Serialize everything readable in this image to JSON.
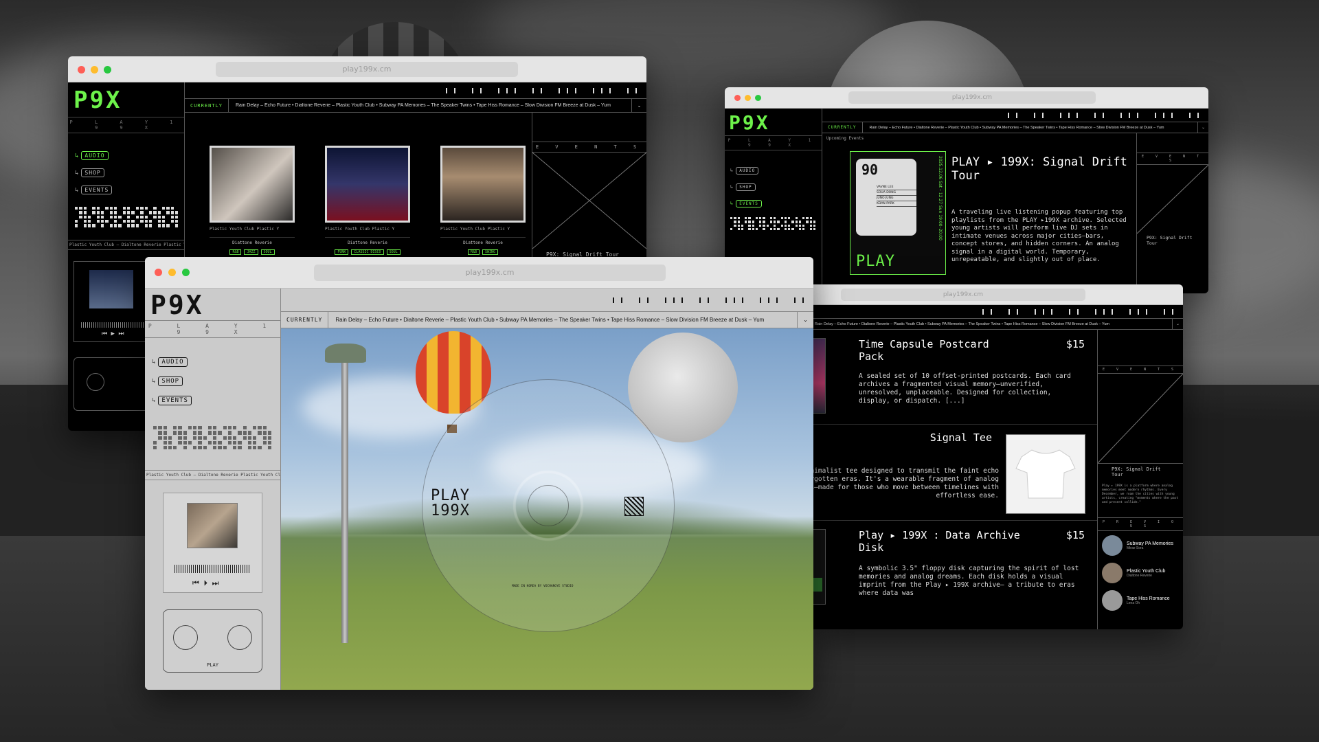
{
  "site": {
    "url": "play199x.cm",
    "logo": "P9X",
    "tagline": "P L A Y   1 9 9 X",
    "nav": [
      "AUDIO",
      "SHOP",
      "EVENTS"
    ],
    "currently_label": "CURRENTLY",
    "ticker": "Rain Delay – Echo Future   •  Dialtone Reverie – Plastic Youth Club   •  Subway PA Memories – The Speaker Twins   •  Tape Hiss Romance – Slow Division   FM Breeze at Dusk – Yum",
    "events_label": "E V E N T S",
    "accent": "#6df24a"
  },
  "win_a": {
    "albums": [
      {
        "artist_line": "Plastic Youth Club  Plastic Y",
        "title": "Diattone Reverie",
        "tags": [
          "R&B",
          "JAZZ",
          "SOUL"
        ]
      },
      {
        "artist_line": "Plastic Youth Club  Plastic Y",
        "title": "Diattone Reverie",
        "tags": [
          "FUNK",
          "CLASSIC DISCO",
          "SOUL"
        ]
      },
      {
        "artist_line": "Plastic Youth Club  Plastic Y",
        "title": "Diattone Reverie",
        "tags": [
          "R&B",
          "SWING"
        ]
      }
    ],
    "strip": "Plastic Youth Club – Dialtone Reverie     Plastic Youth Club",
    "events_caption": "P9X: Signal Drift Tour"
  },
  "win_b": {
    "upcoming": "Upcoming Events",
    "event_title": "PLAY ▸ 199X: Signal Drift Tour",
    "event_desc": "A traveling live listening popup featuring top playlists from the PLAY ▸199X archive. Selected young artists will perform live DJ sets in intimate venues across major cities—bars, concept stores, and hidden corners. An analog signal in a digital world. Temporary, unrepeatable, and slightly out of place.",
    "poster_number": "90",
    "poster_date": "2025.12.06 Sat – 12.27 Sun 19:00–20:00",
    "poster_names": [
      "VAVNE LEE",
      "SOUA DONG",
      "JUNO JUNG",
      "KDAN PARK"
    ],
    "poster_brand": "PLAY",
    "events_caption": "P9X: Signal Drift Tour"
  },
  "win_c": {
    "products": [
      {
        "title": "Time Capsule Postcard Pack",
        "price": "$15",
        "desc": "A sealed set of 10 offset-printed postcards. Each card archives a fragmented visual memory—unverified, unresolved, unplaceable. Designed for collection, display, or dispatch.  [...]"
      },
      {
        "title": "Signal Tee",
        "price": "",
        "desc": "A minimalist tee designed to transmit the faint echo of forgotten eras. It's a wearable fragment of analog dreams—made for those who move between timelines with effortless ease."
      },
      {
        "title": "Play ▸ 199X : Data Archive Disk",
        "price": "$15",
        "desc": "A symbolic 3.5\" floppy disk capturing the spirit of lost memories and analog dreams. Each disk holds a visual imprint from the Play ▸ 199X archive— a tribute to eras where data was"
      }
    ],
    "events_caption": "P9X: Signal Drift Tour",
    "events_text": "Play ▸ 199X is a platform where analog memories meet modern rhythms. Every December, we roam the cities with young artists, creating \"moments where the past and present collide.\"",
    "previous_label": "P R E V I O U S",
    "previous": [
      {
        "title": "Subway PA Memories",
        "artist": "Mirae Sora"
      },
      {
        "title": "Plastic Youth Club",
        "artist": "Dialtone Reverie"
      },
      {
        "title": "Tape Hiss Romance",
        "artist": "Lena Oh"
      }
    ],
    "edge_labels": [
      "Memories",
      "th Club",
      "omance"
    ]
  },
  "win_d": {
    "strip": "Plastic Youth Club – Dialtone Reverie     Plastic Youth Club",
    "cd_brand": "PLAY 199X",
    "cd_fine": "MADE IN KOREA BY VOCHANGYE STUDIO",
    "cassette_label": "PLAY"
  }
}
